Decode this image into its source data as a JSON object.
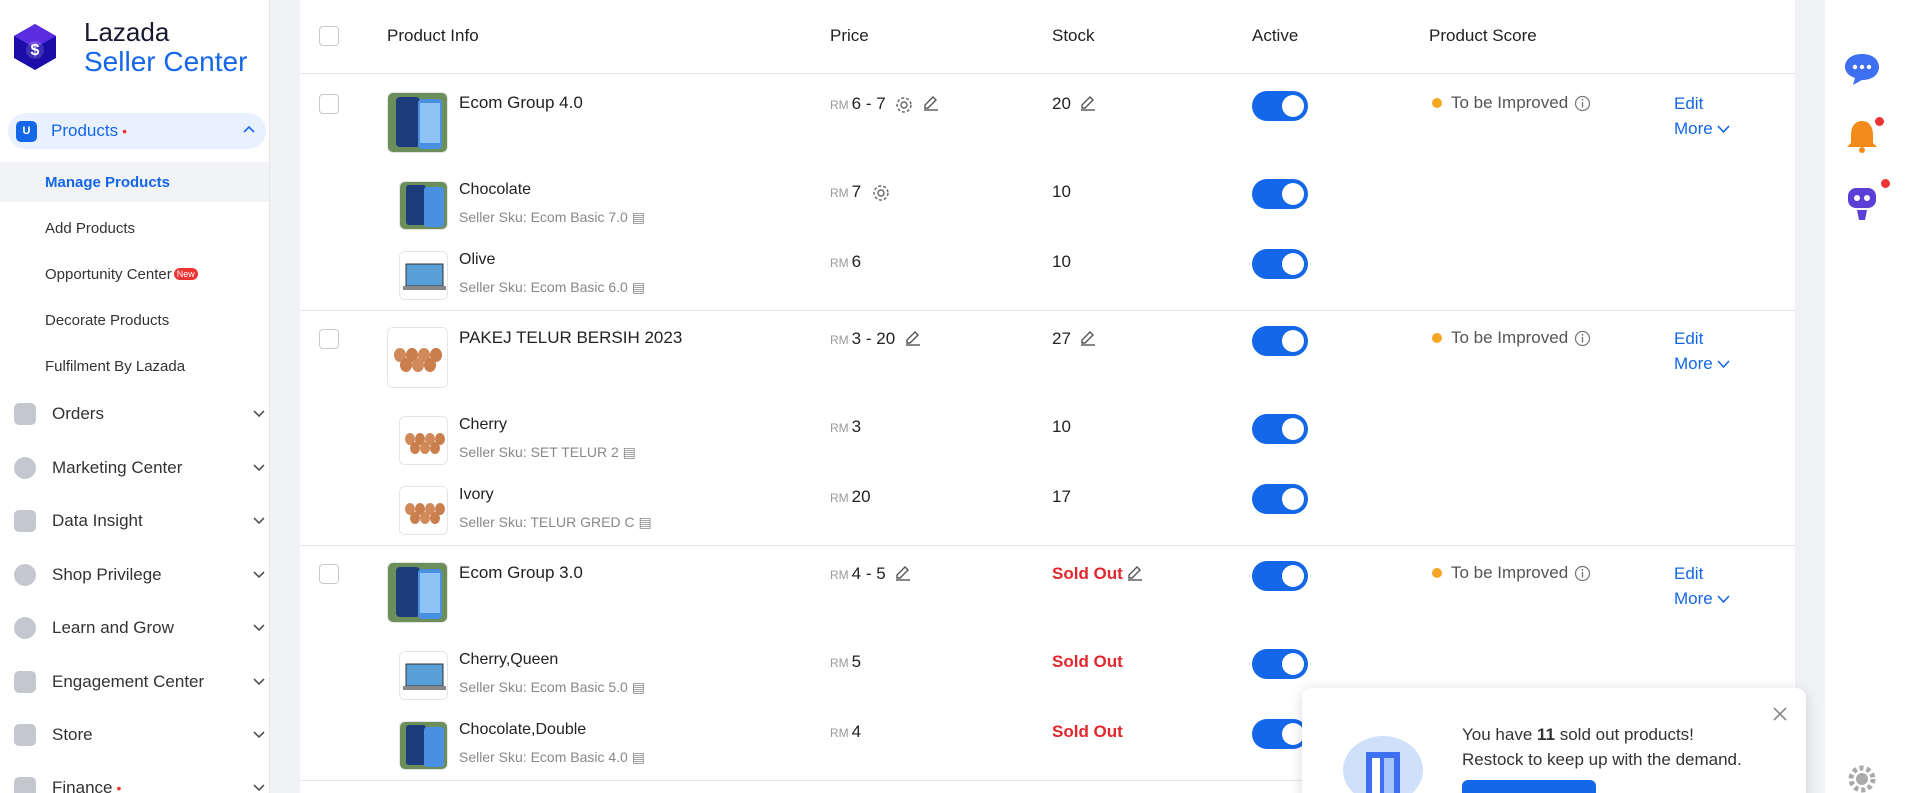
{
  "brand": {
    "line1": "Lazada",
    "line2": "Seller Center"
  },
  "sidebar": {
    "active": {
      "label": "Products",
      "icon": "products-icon"
    },
    "subitems": [
      {
        "label": "Manage Products",
        "selected": true
      },
      {
        "label": "Add Products"
      },
      {
        "label": "Opportunity Center",
        "badge": "New"
      },
      {
        "label": "Decorate Products"
      },
      {
        "label": "Fulfilment By Lazada"
      }
    ],
    "items": [
      {
        "label": "Orders",
        "icon": "orders-icon"
      },
      {
        "label": "Marketing Center",
        "icon": "marketing-icon"
      },
      {
        "label": "Data Insight",
        "icon": "data-insight-icon"
      },
      {
        "label": "Shop Privilege",
        "icon": "shop-privilege-icon"
      },
      {
        "label": "Learn and Grow",
        "icon": "learn-icon"
      },
      {
        "label": "Engagement Center",
        "icon": "engagement-icon"
      },
      {
        "label": "Store",
        "icon": "store-icon"
      },
      {
        "label": "Finance",
        "icon": "finance-icon"
      }
    ]
  },
  "table": {
    "headers": {
      "product_info": "Product Info",
      "price": "Price",
      "stock": "Stock",
      "active": "Active",
      "score": "Product Score"
    },
    "currency": "RM",
    "actions": {
      "edit": "Edit",
      "more": "More"
    },
    "groups": [
      {
        "name": "Ecom Group 4.0",
        "price": "6 - 7",
        "stock": "20",
        "score": "To be Improved",
        "variants": [
          {
            "name": "Chocolate",
            "sku": "Seller Sku: Ecom Basic 7.0",
            "price": "7",
            "stock": "10"
          },
          {
            "name": "Olive",
            "sku": "Seller Sku: Ecom Basic 6.0",
            "price": "6",
            "stock": "10"
          }
        ]
      },
      {
        "name": "PAKEJ TELUR BERSIH 2023",
        "price": "3 - 20",
        "stock": "27",
        "score": "To be Improved",
        "variants": [
          {
            "name": "Cherry",
            "sku": "Seller Sku: SET TELUR 2",
            "price": "3",
            "stock": "10"
          },
          {
            "name": "Ivory",
            "sku": "Seller Sku: TELUR GRED C",
            "price": "20",
            "stock": "17"
          }
        ]
      },
      {
        "name": "Ecom Group 3.0",
        "price": "4 - 5",
        "stock": "Sold Out",
        "score": "To be Improved",
        "variants": [
          {
            "name": "Cherry,Queen",
            "sku": "Seller Sku: Ecom Basic 5.0",
            "price": "5",
            "stock": "Sold Out"
          },
          {
            "name": "Chocolate,Double",
            "sku": "Seller Sku: Ecom Basic 4.0",
            "price": "4",
            "stock": "Sold Out"
          }
        ]
      }
    ]
  },
  "toast": {
    "prefix": "You have ",
    "count": "11",
    "suffix": " sold out products!",
    "line2": "Restock to keep up with the demand."
  },
  "colors": {
    "accent": "#1467e8",
    "soldout": "#e0282e",
    "warning": "#f5a623"
  }
}
